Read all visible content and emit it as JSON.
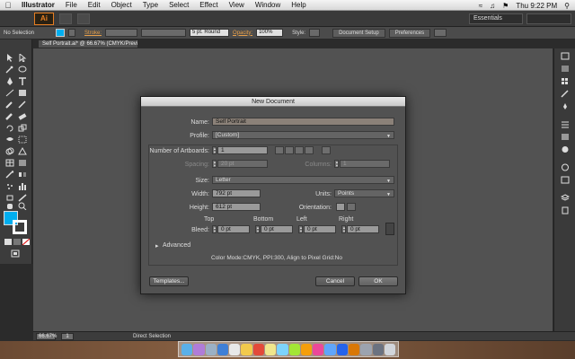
{
  "menubar": {
    "app_name": "Illustrator",
    "items": [
      "File",
      "Edit",
      "Object",
      "Type",
      "Select",
      "Effect",
      "View",
      "Window",
      "Help"
    ],
    "clock": "Thu 9:22 PM"
  },
  "appbar": {
    "logo": "Ai",
    "workspace": "Essentials"
  },
  "controlbar": {
    "selection": "No Selection",
    "stroke_label": "Stroke:",
    "brush": "5 pt. Round",
    "opacity_label": "Opacity:",
    "opacity_value": "100%",
    "style_label": "Style:",
    "doc_setup": "Document Setup",
    "preferences": "Preferences"
  },
  "document_tab": "Self Portrait.ai* @ 66.67% (CMYK/Preview)",
  "statusbar": {
    "zoom": "66.67%",
    "page": "1",
    "status": "Direct Selection"
  },
  "dialog": {
    "title": "New Document",
    "name_label": "Name:",
    "name_value": "Self Portrait",
    "profile_label": "Profile:",
    "profile_value": "[Custom]",
    "artboards_label": "Number of Artboards:",
    "artboards_value": "1",
    "spacing_label": "Spacing:",
    "spacing_value": "20 pt",
    "columns_label": "Columns:",
    "columns_value": "1",
    "size_label": "Size:",
    "size_value": "Letter",
    "width_label": "Width:",
    "width_value": "792 pt",
    "units_label": "Units:",
    "units_value": "Points",
    "height_label": "Height:",
    "height_value": "612 pt",
    "orientation_label": "Orientation:",
    "bleed_label": "Bleed:",
    "bleed_top_label": "Top",
    "bleed_bottom_label": "Bottom",
    "bleed_left_label": "Left",
    "bleed_right_label": "Right",
    "bleed_top": "0 pt",
    "bleed_bottom": "0 pt",
    "bleed_left": "0 pt",
    "bleed_right": "0 pt",
    "advanced_label": "Advanced",
    "summary": "Color Mode:CMYK, PPI:300, Align to Pixel Grid:No",
    "templates_button": "Templates...",
    "cancel_button": "Cancel",
    "ok_button": "OK"
  },
  "colors": {
    "fill": "#00aeef",
    "accent": "#e67e22"
  }
}
